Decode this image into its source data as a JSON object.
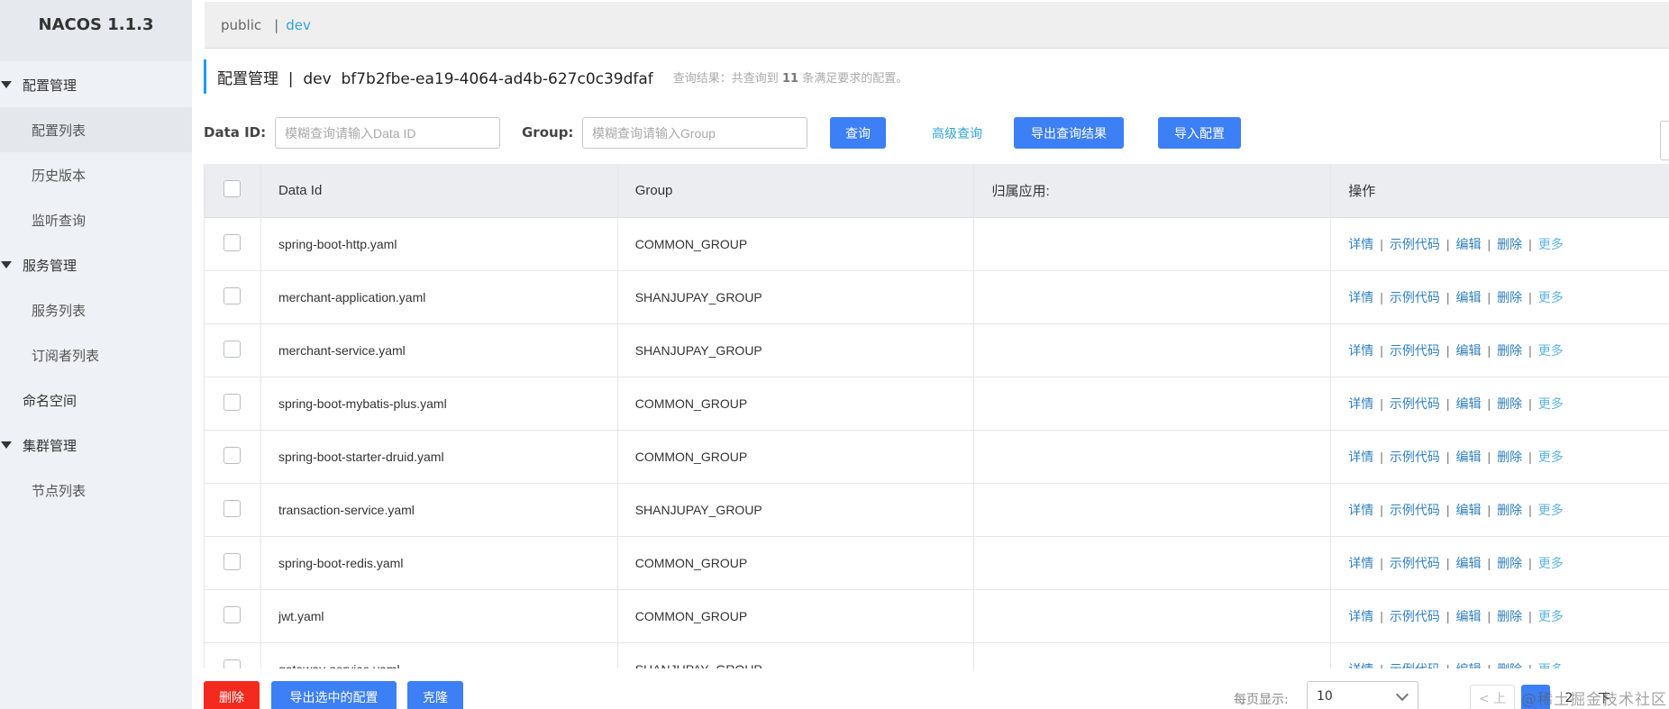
{
  "sidebar": {
    "brand": "NACOS 1.1.3",
    "config_group": "配置管理",
    "config_items": [
      "配置列表",
      "历史版本",
      "监听查询"
    ],
    "service_group": "服务管理",
    "service_items": [
      "服务列表",
      "订阅者列表"
    ],
    "namespace": "命名空间",
    "cluster_group": "集群管理",
    "cluster_items": [
      "节点列表"
    ]
  },
  "topbar": {
    "ns_public": "public",
    "separator": "|",
    "ns_dev": "dev"
  },
  "header": {
    "title": "配置管理  |  dev  bf7b2fbe-ea19-4064-ad4b-627c0c39dfaf",
    "result_prefix": "查询结果：共查询到",
    "result_count": "11",
    "result_suffix": "条满足要求的配置。"
  },
  "search": {
    "dataid_label": "Data ID:",
    "dataid_placeholder": "模糊查询请输入Data ID",
    "group_label": "Group:",
    "group_placeholder": "模糊查询请输入Group",
    "query_button": "查询",
    "advanced_link": "高级查询",
    "export_button": "导出查询结果",
    "import_button": "导入配置"
  },
  "table": {
    "headers": [
      "Data Id",
      "Group",
      "归属应用:",
      "操作"
    ],
    "rows": [
      {
        "data_id": "spring-boot-http.yaml",
        "group": "COMMON_GROUP",
        "app": ""
      },
      {
        "data_id": "merchant-application.yaml",
        "group": "SHANJUPAY_GROUP",
        "app": ""
      },
      {
        "data_id": "merchant-service.yaml",
        "group": "SHANJUPAY_GROUP",
        "app": ""
      },
      {
        "data_id": "spring-boot-mybatis-plus.yaml",
        "group": "COMMON_GROUP",
        "app": ""
      },
      {
        "data_id": "spring-boot-starter-druid.yaml",
        "group": "COMMON_GROUP",
        "app": ""
      },
      {
        "data_id": "transaction-service.yaml",
        "group": "SHANJUPAY_GROUP",
        "app": ""
      },
      {
        "data_id": "spring-boot-redis.yaml",
        "group": "COMMON_GROUP",
        "app": ""
      },
      {
        "data_id": "jwt.yaml",
        "group": "COMMON_GROUP",
        "app": ""
      },
      {
        "data_id": "gateway-service.yaml",
        "group": "SHANJUPAY_GROUP",
        "app": ""
      }
    ],
    "actions": {
      "detail": "详情",
      "sample": "示例代码",
      "edit": "编辑",
      "delete": "删除",
      "more": "更多"
    }
  },
  "footer": {
    "delete_button": "删除",
    "export_selected_button": "导出选中的配置",
    "clone_button": "克隆",
    "per_page_label": "每页显示:",
    "per_page_value": "10",
    "prev_label": "< 上",
    "page_next_number": "2",
    "next_label": "下",
    "watermark": "@稀土掘金技术社区"
  },
  "colors": {
    "primary": "#3d7ff5",
    "danger": "#f52a1f",
    "link": "#2f7fbf",
    "accent": "#33a4d6"
  }
}
